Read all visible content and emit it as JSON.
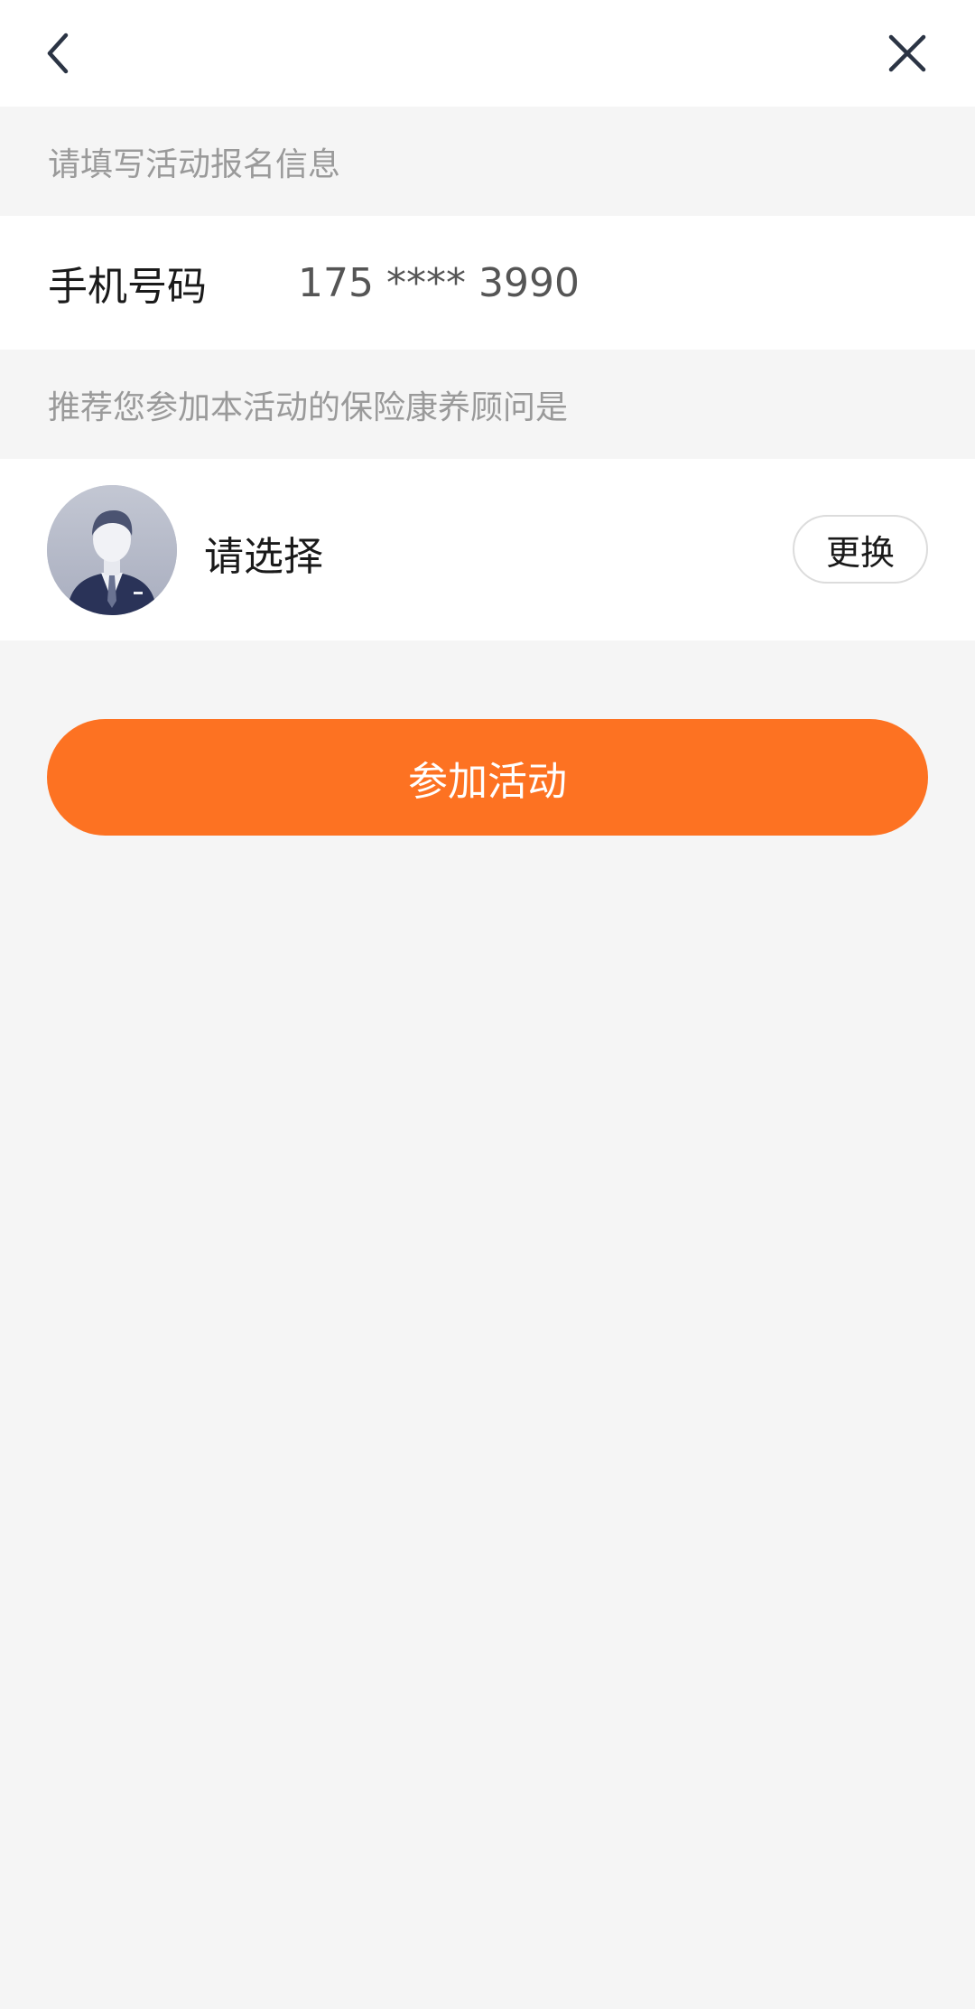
{
  "nav": {
    "back_icon": "chevron-left-icon",
    "close_icon": "close-icon"
  },
  "form": {
    "header": "请填写活动报名信息",
    "phone_label": "手机号码",
    "phone_value": "175 **** 3990"
  },
  "advisor": {
    "header": "推荐您参加本活动的保险康养顾问是",
    "name": "请选择",
    "change_label": "更换",
    "avatar_icon": "user-avatar-icon"
  },
  "actions": {
    "join_label": "参加活动"
  },
  "colors": {
    "accent": "#fd7222",
    "background": "#f5f5f5"
  }
}
